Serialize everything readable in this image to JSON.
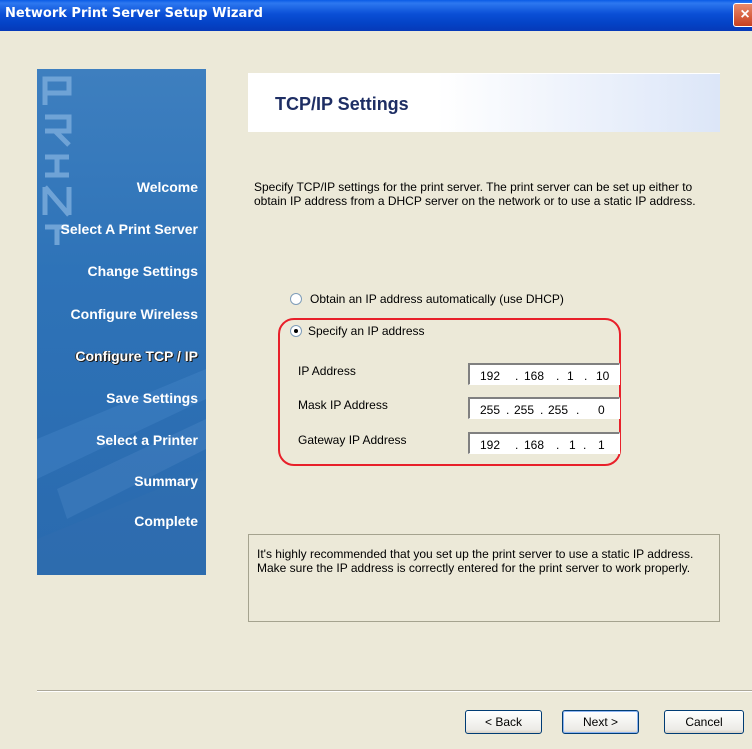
{
  "window": {
    "title": "Network Print Server Setup Wizard",
    "close_glyph": "×"
  },
  "sidebar": {
    "items": [
      {
        "label": "Welcome"
      },
      {
        "label": "Select A Print Server"
      },
      {
        "label": "Change Settings"
      },
      {
        "label": "Configure Wireless"
      },
      {
        "label": "Configure TCP / IP",
        "current": true
      },
      {
        "label": "Save Settings"
      },
      {
        "label": "Select a Printer"
      },
      {
        "label": "Summary"
      },
      {
        "label": "Complete"
      }
    ]
  },
  "header": {
    "title": "TCP/IP Settings"
  },
  "description": "Specify TCP/IP settings for the print server. The print server can be set up either to obtain IP address from a DHCP server on the network or to use a static IP address.",
  "options": {
    "dhcp_label": "Obtain an IP address automatically (use DHCP)",
    "static_label": "Specify an IP address",
    "selected": "static"
  },
  "fields": {
    "ip": {
      "label": "IP Address",
      "octets": [
        "192",
        "168",
        "1",
        "10"
      ]
    },
    "mask": {
      "label": "Mask IP Address",
      "octets": [
        "255",
        "255",
        "255",
        "0"
      ]
    },
    "gateway": {
      "label": "Gateway IP Address",
      "octets": [
        "192",
        "168",
        "1",
        "1"
      ]
    },
    "dot": "."
  },
  "note": "It's highly recommended that you set up the print server to use a static IP address. Make sure the IP address is correctly entered for the print server to work properly.",
  "buttons": {
    "back": "< Back",
    "next": "Next >",
    "cancel": "Cancel"
  },
  "colors": {
    "accent_ring": "#E8202A",
    "sidebar": "#2E73B8",
    "titlebar": "#0A4FD6"
  }
}
